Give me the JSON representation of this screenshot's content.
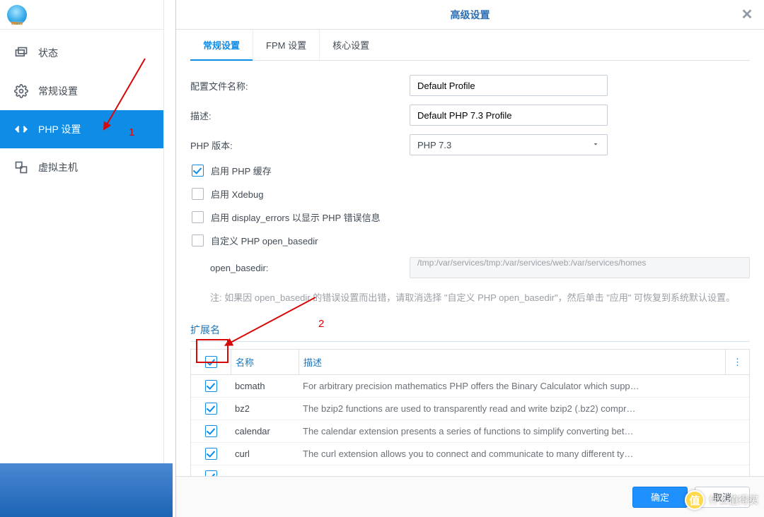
{
  "sidebar": {
    "items": [
      {
        "label": "状态"
      },
      {
        "label": "常规设置"
      },
      {
        "label": "PHP 设置"
      },
      {
        "label": "虚拟主机"
      }
    ],
    "active_index": 2
  },
  "modal": {
    "title": "高级设置",
    "tabs": [
      {
        "label": "常规设置"
      },
      {
        "label": "FPM 设置"
      },
      {
        "label": "核心设置"
      }
    ],
    "active_tab": 0,
    "form": {
      "profile_label": "配置文件名称:",
      "profile_value": "Default Profile",
      "desc_label": "描述:",
      "desc_value": "Default PHP 7.3 Profile",
      "version_label": "PHP 版本:",
      "version_value": "PHP 7.3",
      "enable_cache_label": "启用 PHP 缓存",
      "enable_cache_checked": true,
      "enable_xdebug_label": "启用 Xdebug",
      "enable_xdebug_checked": false,
      "display_errors_label": "启用 display_errors 以显示 PHP 错误信息",
      "display_errors_checked": false,
      "custom_basedir_label": "自定义 PHP open_basedir",
      "custom_basedir_checked": false,
      "basedir_label": "open_basedir:",
      "basedir_value": "/tmp:/var/services/tmp:/var/services/web:/var/services/homes",
      "note": "注:  如果因 open_basedir 的错误设置而出错，请取消选择 \"自定义 PHP open_basedir\"，然后单击 \"应用\" 可恢复到系统默认设置。"
    },
    "ext_section_title": "扩展名",
    "ext_table": {
      "col_name": "名称",
      "col_desc": "描述",
      "select_all_checked": true,
      "rows": [
        {
          "checked": true,
          "name": "bcmath",
          "desc": "For arbitrary precision mathematics PHP offers the Binary Calculator which supp…"
        },
        {
          "checked": true,
          "name": "bz2",
          "desc": "The bzip2 functions are used to transparently read and write bzip2 (.bz2) compr…"
        },
        {
          "checked": true,
          "name": "calendar",
          "desc": "The calendar extension presents a series of functions to simplify converting bet…"
        },
        {
          "checked": true,
          "name": "curl",
          "desc": "The curl extension allows you to connect and communicate to many different ty…"
        }
      ]
    },
    "buttons": {
      "ok": "确定",
      "cancel": "取消"
    }
  },
  "annotations": {
    "label1": "1",
    "label2": "2"
  },
  "watermark": {
    "badge": "值",
    "text": "什么值得买"
  }
}
